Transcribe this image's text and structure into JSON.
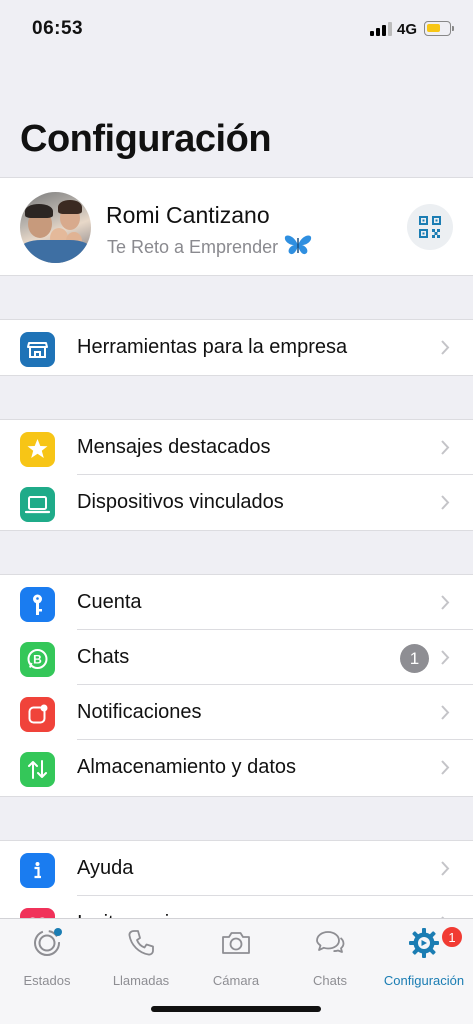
{
  "status_bar": {
    "time": "06:53",
    "network": "4G",
    "battery_level": 0.6,
    "battery_color": "#f7c616"
  },
  "title": "Configuración",
  "profile": {
    "name": "Romi Cantizano",
    "status": "Te Reto a Emprender",
    "status_emoji": "butterfly-icon",
    "qr_icon": "qr-code-icon"
  },
  "sections": {
    "business": [
      {
        "label": "Herramientas para la empresa",
        "icon": "store-icon",
        "color": "#1f73b7"
      }
    ],
    "starred": [
      {
        "label": "Mensajes destacados",
        "icon": "star-icon",
        "color": "#f7c516"
      },
      {
        "label": "Dispositivos vinculados",
        "icon": "laptop-icon",
        "color": "#1fab89"
      }
    ],
    "main": [
      {
        "label": "Cuenta",
        "icon": "key-icon",
        "color": "#1a7cf0"
      },
      {
        "label": "Chats",
        "icon": "whatsapp-business-icon",
        "color": "#34c759",
        "badge": "1"
      },
      {
        "label": "Notificaciones",
        "icon": "notification-icon",
        "color": "#f0433a"
      },
      {
        "label": "Almacenamiento y datos",
        "icon": "arrows-updown-icon",
        "color": "#34c759"
      }
    ],
    "help": [
      {
        "label": "Ayuda",
        "icon": "info-icon",
        "color": "#1a7cf0"
      },
      {
        "label": "Invitar amigos",
        "icon": "heart-icon",
        "color": "#f0325a"
      }
    ]
  },
  "tab_bar": {
    "tabs": [
      {
        "label": "Estados",
        "icon": "status-icon"
      },
      {
        "label": "Llamadas",
        "icon": "phone-icon"
      },
      {
        "label": "Cámara",
        "icon": "camera-icon"
      },
      {
        "label": "Chats",
        "icon": "chat-bubbles-icon"
      },
      {
        "label": "Configuración",
        "icon": "settings-gear-icon",
        "badge": "1",
        "active": true
      }
    ],
    "accent": "#1b7db3"
  }
}
